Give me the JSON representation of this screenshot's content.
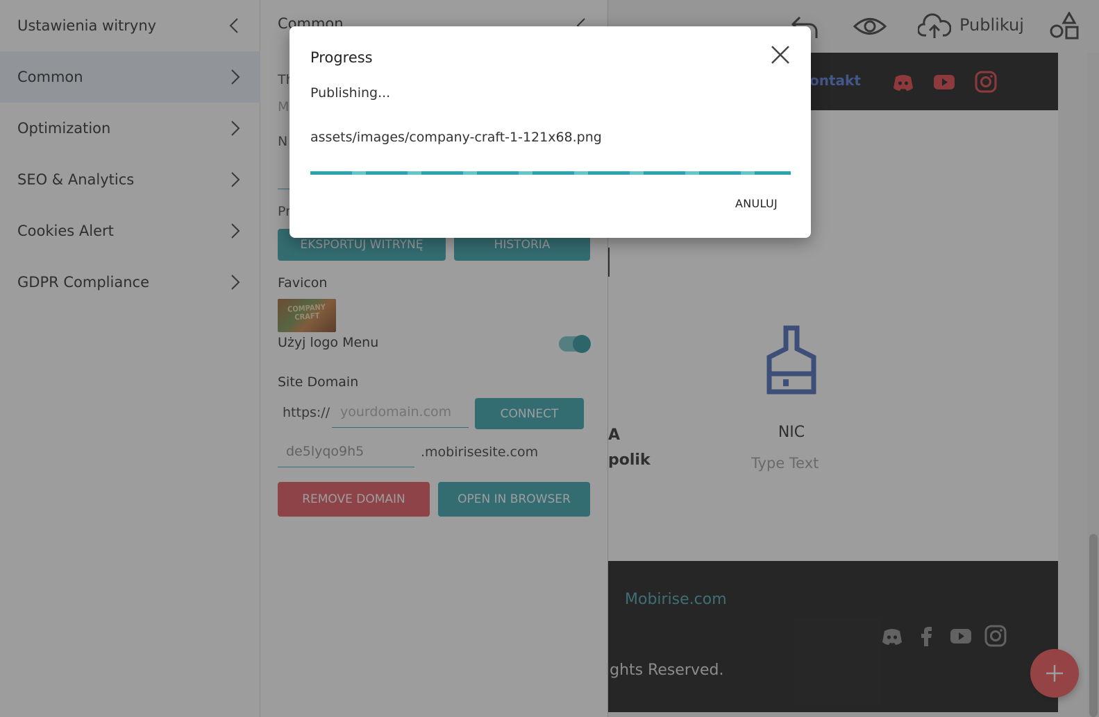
{
  "sidebar": {
    "title": "Ustawienia witryny",
    "items": [
      {
        "label": "Common"
      },
      {
        "label": "Optimization"
      },
      {
        "label": "SEO & Analytics"
      },
      {
        "label": "Cookies Alert"
      },
      {
        "label": "GDPR Compliance"
      }
    ]
  },
  "panel": {
    "title": "Common",
    "frag_th": "Th",
    "frag_m": "M",
    "frag_n": "N",
    "frag_pr": "Pr",
    "export_label": "EKSPORTUJ WITRYNĘ",
    "history_label": "HISTORIA",
    "favicon_label": "Favicon",
    "favicon_image_text": "COMPANY CRAFT",
    "use_logo_label": "Użyj logo Menu",
    "use_logo_enabled": true,
    "site_domain_label": "Site Domain",
    "https_prefix": "https://",
    "domain_placeholder": "yourdomain.com",
    "connect_label": "CONNECT",
    "subdomain_value": "de5lyqo9h5",
    "subdomain_suffix": ".mobirisesite.com",
    "remove_label": "REMOVE DOMAIN",
    "open_label": "OPEN IN BROWSER"
  },
  "topbar": {
    "publish_label": "Publikuj",
    "icons": [
      "undo-icon",
      "eye-icon",
      "cloud-upload-icon",
      "blocks-icon"
    ]
  },
  "preview": {
    "nav_link": "ontakt",
    "nav_icons": [
      "discord-icon",
      "youtube-icon",
      "instagram-icon"
    ],
    "frag_a": "A",
    "frag_polik": "polik",
    "card_title": "NIC",
    "card_text": "Type Text",
    "footer_link": "Mobirise.com",
    "footer_rights": "ights Reserved.",
    "footer_icons": [
      "discord-icon",
      "facebook-icon",
      "youtube-icon",
      "instagram-icon"
    ]
  },
  "modal": {
    "title": "Progress",
    "status": "Publishing...",
    "file": "assets/images/company-craft-1-121x68.png",
    "progress": 1.0,
    "cancel_label": "ANULUJ"
  },
  "colors": {
    "teal": "#2a9ea8",
    "red": "#e04b55",
    "accent_blue": "#4d73d8",
    "nav_icon_red": "#e0383e",
    "brush_blue": "#3f63b5"
  }
}
